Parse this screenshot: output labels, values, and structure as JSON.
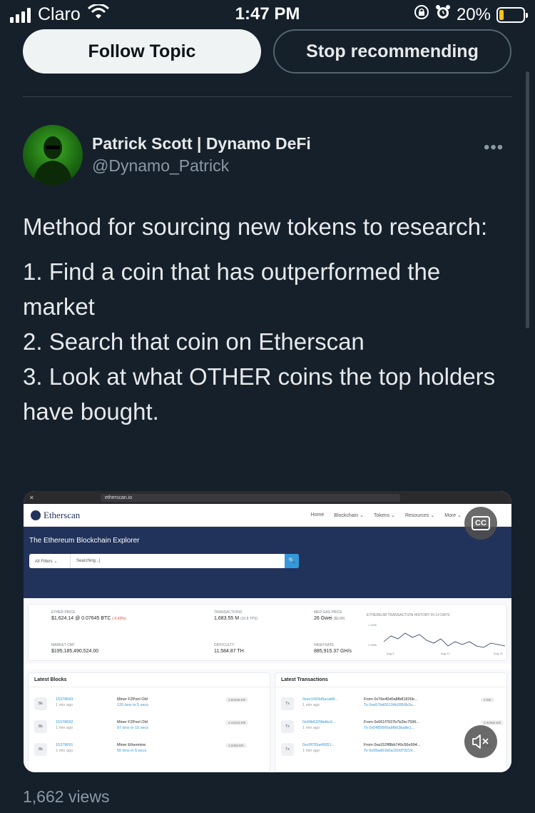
{
  "status_bar": {
    "carrier": "Claro",
    "time": "1:47 PM",
    "battery_percent": "20%",
    "battery_level": 0.2,
    "battery_color": "#f5c518",
    "icons": [
      "signal-icon",
      "wifi-icon",
      "orientation-lock-icon",
      "alarm-icon",
      "battery-icon"
    ]
  },
  "actions": {
    "follow_label": "Follow Topic",
    "stop_label": "Stop recommending"
  },
  "author": {
    "name": "Patrick Scott | Dynamo DeFi",
    "handle": "@Dynamo_Patrick",
    "more": "•••"
  },
  "tweet": {
    "line1": "Method for sourcing new tokens to research:",
    "line2": "1. Find a coin that has outperformed the market",
    "line3": "2. Search that coin on Etherscan",
    "line4": "3. Look at what OTHER coins the top holders have bought."
  },
  "media": {
    "url": "etherscan.io",
    "logo": "Etherscan",
    "menu": [
      "Home",
      "Blockchain ⌄",
      "Tokens ⌄",
      "Resources ⌄",
      "More ⌄"
    ],
    "hero_title": "The Ethereum Blockchain Explorer",
    "filter_label": "All Filters  ⌄",
    "search_text": "Searching ..|",
    "search_button": "🔍",
    "stats": {
      "ether_price_label": "ETHER PRICE",
      "ether_price_value": "$1,624.14 @ 0.07645 BTC",
      "ether_price_change": "(-5.43%)",
      "transactions_label": "TRANSACTIONS",
      "transactions_value": "1,683.55 M",
      "transactions_tps": "(10.8 TPS)",
      "gas_label": "MED GAS PRICE",
      "gas_value": "26 Gwei",
      "gas_usd": "($0.89)",
      "market_cap_label": "MARKET CAP",
      "market_cap_value": "$195,185,490,524.00",
      "difficulty_label": "DIFFICULTY",
      "difficulty_value": "11,584.87 TH",
      "hashrate_label": "HASH RATE",
      "hashrate_value": "885,915.37 GH/s",
      "chart_title": "ETHEREUM TRANSACTION HISTORY IN 14 DAYS",
      "chart_y_top": "1 240k",
      "chart_y_bottom": "1 090k",
      "chart_x": [
        "Aug 5",
        "Aug 12",
        "Aug 19"
      ]
    },
    "latest_blocks_title": "Latest Blocks",
    "latest_tx_title": "Latest Transactions",
    "blocks": [
      {
        "num": "15378693",
        "age": "1 min ago",
        "miner": "Miner F2Pool Old",
        "txns": "120 txns in 5 secs",
        "reward": "2.63108 Eth"
      },
      {
        "num": "15378692",
        "age": "1 min ago",
        "miner": "Miner F2Pool Old",
        "txns": "97 txns in 10 secs",
        "reward": "2.14216 Eth"
      },
      {
        "num": "15378691",
        "age": "1 min ago",
        "miner": "Miner Ethermine",
        "txns": "56 txns in 6 secs",
        "reward": "2.0368 Eth"
      }
    ],
    "transactions": [
      {
        "hash": "0xee1683d6acad9...",
        "age": "1 min ago",
        "from": "From 0x76e40d0a8fb81826b...",
        "to": "To 0xa57bd00134b2850b2a...",
        "value": "0 Eth"
      },
      {
        "hash": "0x99b6329bdbc6...",
        "age": "1 min ago",
        "from": "From 0x061f7937b7b2bc7596...",
        "to": "To 0x0489966abfb63ba8e1...",
        "value": "0.02365 Eth"
      },
      {
        "hash": "0xc0f755a40051...",
        "age": "1 min ago",
        "from": "From 0xa152ff8bb749c56e994...",
        "to": "To 0x95ad61b0a150d79219...",
        "value": "0 Eth"
      }
    ],
    "block_badge": "Bk",
    "tx_badge": "Tx"
  },
  "controls": {
    "captions_label": "CC",
    "mute_label": "🔇"
  },
  "footer": {
    "views": "1,662 views"
  }
}
